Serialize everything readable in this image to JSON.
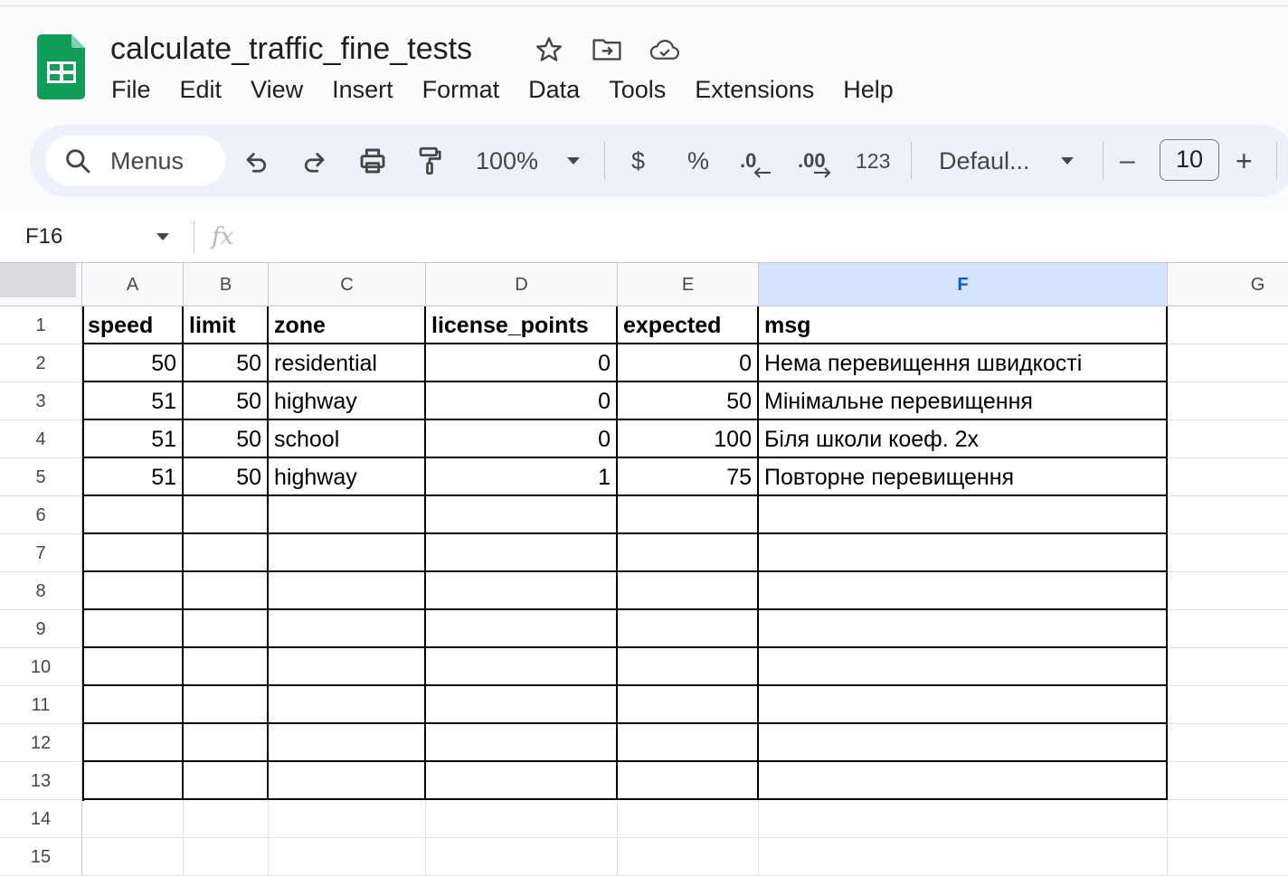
{
  "app": {
    "doc_title": "calculate_traffic_fine_tests",
    "title_icons": [
      "star-icon",
      "move-to-folder-icon",
      "cloud-saved-icon"
    ]
  },
  "menu": [
    "File",
    "Edit",
    "View",
    "Insert",
    "Format",
    "Data",
    "Tools",
    "Extensions",
    "Help"
  ],
  "toolbar": {
    "search_label": "Menus",
    "zoom": "100%",
    "currency": "$",
    "percent": "%",
    "decrease_decimal": ".0",
    "increase_decimal": ".00",
    "number_format": "123",
    "font": "Defaul...",
    "font_size": "10",
    "minus": "–",
    "plus": "+"
  },
  "formula_bar": {
    "name_box": "F16",
    "fx": "fx"
  },
  "grid": {
    "columns": [
      "A",
      "B",
      "C",
      "D",
      "E",
      "F",
      "G"
    ],
    "selected_column": "F",
    "rows": [
      "1",
      "2",
      "3",
      "4",
      "5",
      "6",
      "7",
      "8",
      "9",
      "10",
      "11",
      "12",
      "13",
      "14",
      "15"
    ],
    "cells": [
      [
        "speed",
        "limit",
        "zone",
        "license_points",
        "expected",
        "msg"
      ],
      [
        "50",
        "50",
        "residential",
        "0",
        "0",
        "Нема перевищення швидкості"
      ],
      [
        "51",
        "50",
        "highway",
        "0",
        "50",
        "Мінімальне перевищення"
      ],
      [
        "51",
        "50",
        "school",
        "0",
        "100",
        "Біля школи коеф. 2x"
      ],
      [
        "51",
        "50",
        "highway",
        "1",
        "75",
        "Повторне перевищення"
      ]
    ]
  },
  "colors": {
    "sheets_green": "#0f9d58",
    "toolbar_bg": "#edf2fa",
    "selected_header": "#d3e3fd"
  }
}
